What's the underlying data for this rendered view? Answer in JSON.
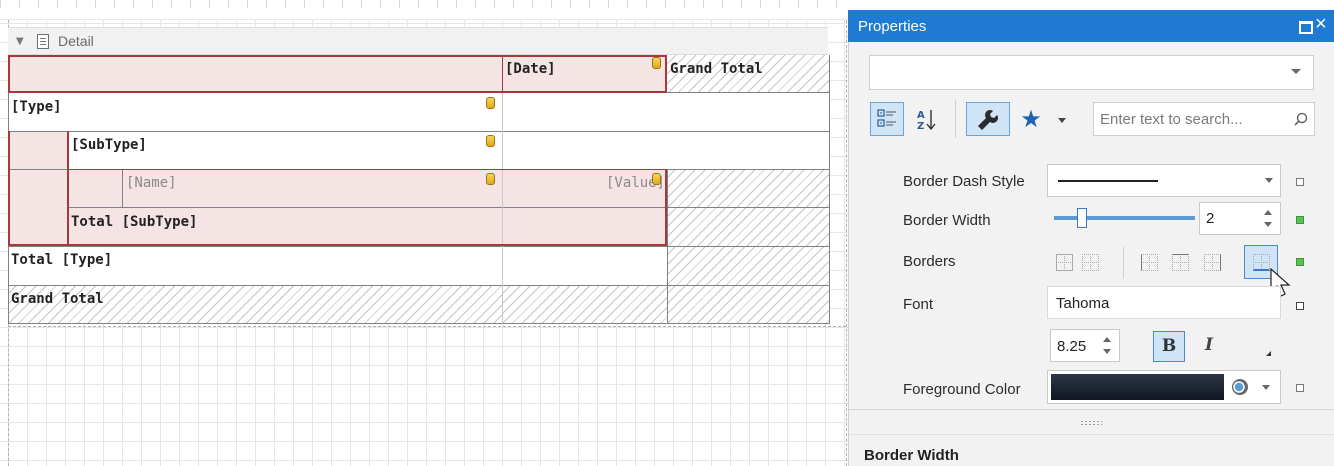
{
  "designer": {
    "band_label": "Detail",
    "cells": {
      "date": "[Date]",
      "grand_total_col": "Grand Total",
      "type": "[Type]",
      "subtype": "[SubType]",
      "name": "[Name]",
      "value": "[Value]",
      "total_subtype": "Total [SubType]",
      "total_type": "Total [Type]",
      "grand_total_row": "Grand Total"
    }
  },
  "panel": {
    "title": "Properties",
    "toolbar": {
      "categorized_icon": "categorized-icon",
      "alphabetical_icon": "sort-az-icon",
      "properties_icon": "wrench-icon",
      "favorites_icon": "star-icon",
      "search_placeholder": "Enter text to search..."
    },
    "properties": [
      {
        "key": "border_dash_style",
        "label": "Border Dash Style",
        "value": "solid-line"
      },
      {
        "key": "border_width",
        "label": "Border Width",
        "value": "2",
        "slider_fraction": 0.15
      },
      {
        "key": "borders",
        "label": "Borders"
      },
      {
        "key": "font",
        "label": "Font",
        "value": "Tahoma",
        "size": "8.25",
        "bold": "B",
        "italic": "I"
      },
      {
        "key": "foreground_color",
        "label": "Foreground Color",
        "value": "#1b2230"
      }
    ],
    "description_title": "Border Width",
    "colors": {
      "accent": "#1e7ad3",
      "cell_pink": "#f5e4e4",
      "cell_border": "#a8383a",
      "modified": "#5cbf52"
    }
  }
}
